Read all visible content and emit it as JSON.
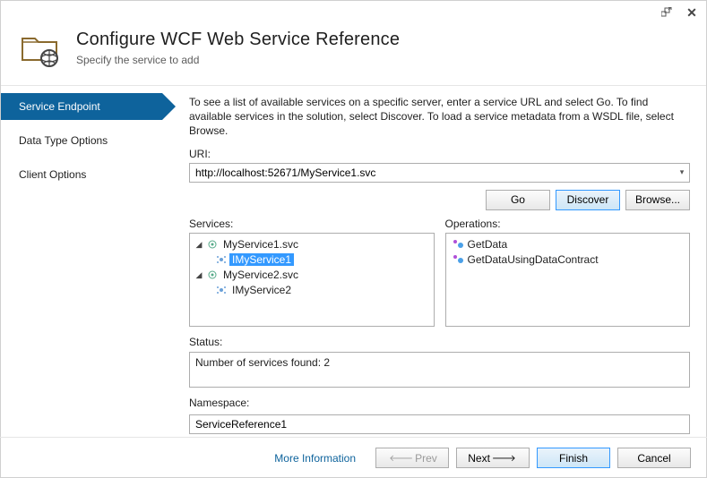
{
  "titlebar": {
    "extra_icon": "extra-icon",
    "close_icon": "close-icon"
  },
  "header": {
    "title": "Configure WCF Web Service Reference",
    "subtitle": "Specify the service to add"
  },
  "sidebar": {
    "items": [
      {
        "label": "Service Endpoint",
        "active": true
      },
      {
        "label": "Data Type Options",
        "active": false
      },
      {
        "label": "Client Options",
        "active": false
      }
    ]
  },
  "content": {
    "instruction": "To see a list of available services on a specific server, enter a service URL and select Go. To find available services in the solution, select Discover.  To load a service metadata from a WSDL file, select Browse.",
    "uri_label": "URI:",
    "uri_value": "http://localhost:52671/MyService1.svc",
    "buttons": {
      "go": "Go",
      "discover": "Discover",
      "browse": "Browse..."
    },
    "services_label": "Services:",
    "operations_label": "Operations:",
    "services_tree": [
      {
        "type": "root",
        "label": "MyService1.svc",
        "expanded": true
      },
      {
        "type": "child",
        "label": "IMyService1",
        "selected": true
      },
      {
        "type": "root",
        "label": "MyService2.svc",
        "expanded": true
      },
      {
        "type": "child",
        "label": "IMyService2",
        "selected": false
      }
    ],
    "operations": [
      {
        "label": "GetData"
      },
      {
        "label": "GetDataUsingDataContract"
      }
    ],
    "status_label": "Status:",
    "status_text": "Number of services found: 2",
    "namespace_label": "Namespace:",
    "namespace_value": "ServiceReference1"
  },
  "footer": {
    "more_info": "More Information",
    "prev": "Prev",
    "next": "Next",
    "finish": "Finish",
    "cancel": "Cancel"
  }
}
